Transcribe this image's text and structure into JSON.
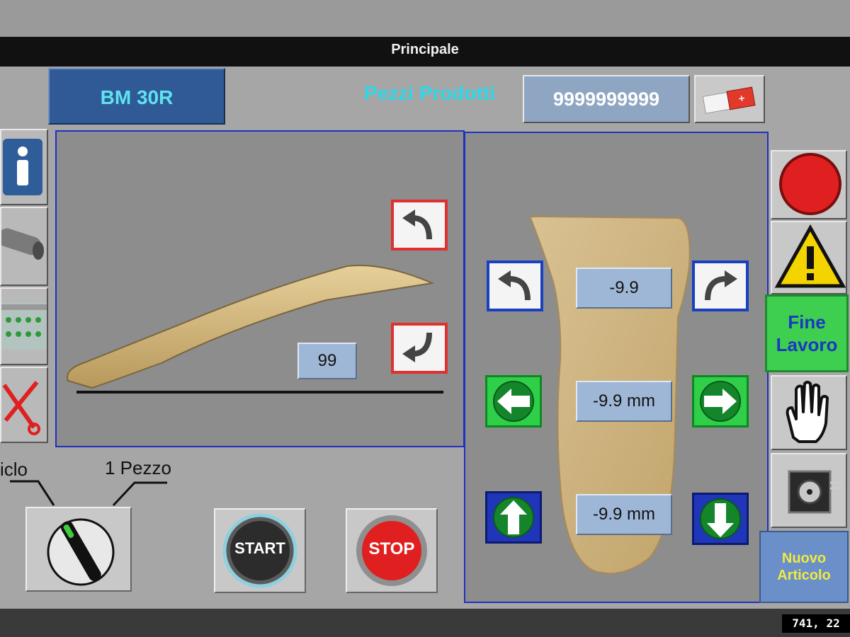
{
  "window": {
    "title": "Principale"
  },
  "header": {
    "model_label": "BM 30R",
    "pieces_label": "Pezzi Prodotti",
    "pieces_value": "9999999999"
  },
  "left_panel": {
    "angle_value": "99"
  },
  "right_panel": {
    "rotation_value": "-9.9",
    "horizontal_value": "-9.9 mm",
    "vertical_value": "-9.9 mm"
  },
  "mode_selector": {
    "left_label": "iclo",
    "right_label": "1 Pezzo"
  },
  "buttons": {
    "start": "START",
    "stop": "STOP",
    "fine_line1": "Fine",
    "fine_line2": "Lavoro",
    "nuovo_line1": "Nuovo",
    "nuovo_line2": "Articolo"
  },
  "status": {
    "coordinates": "741, 22"
  },
  "colors": {
    "accent_cyan": "#2fd8e8",
    "panel_border": "#2030c0",
    "green": "#2fcf4a",
    "stop_red": "#e02020"
  }
}
